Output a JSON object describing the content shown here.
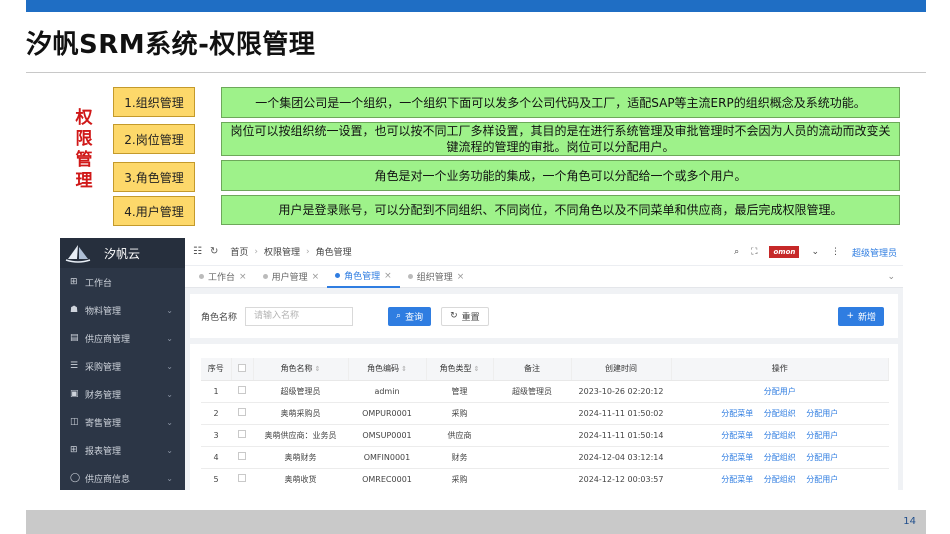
{
  "slide": {
    "title": "汐帆SRM系统-权限管理",
    "vertical_label": [
      "权",
      "限",
      "管",
      "理"
    ],
    "page_number": "14",
    "concepts": [
      {
        "label": "1.组织管理",
        "desc": "一个集团公司是一个组织，一个组织下面可以发多个公司代码及工厂，适配SAP等主流ERP的组织概念及系统功能。"
      },
      {
        "label": "2.岗位管理",
        "desc": "岗位可以按组织统一设置，也可以按不同工厂多样设置，其目的是在进行系统管理及审批管理时不会因为人员的流动而改变关键流程的管理的审批。岗位可以分配用户。"
      },
      {
        "label": "3.角色管理",
        "desc": "角色是对一个业务功能的集成，一个角色可以分配给一个或多个用户。"
      },
      {
        "label": "4.用户管理",
        "desc": "用户是登录账号，可以分配到不同组织、不同岗位，不同角色以及不同菜单和供应商，最后完成权限管理。"
      }
    ]
  },
  "app": {
    "brand": "汐帆云",
    "sidebar": [
      {
        "label": "工作台",
        "icon": "grid-icon"
      },
      {
        "label": "物料管理",
        "icon": "cubes-icon"
      },
      {
        "label": "供应商管理",
        "icon": "id-card-icon"
      },
      {
        "label": "采购管理",
        "icon": "list-icon"
      },
      {
        "label": "财务管理",
        "icon": "ledger-icon"
      },
      {
        "label": "寄售管理",
        "icon": "box-icon"
      },
      {
        "label": "报表管理",
        "icon": "grid-icon"
      },
      {
        "label": "供应商信息",
        "icon": "chat-icon"
      }
    ],
    "breadcrumb": [
      "首页",
      "权限管理",
      "角色管理"
    ],
    "user": "超级管理员",
    "badge_text": "omon",
    "tabs": [
      {
        "label": "工作台",
        "active": false
      },
      {
        "label": "用户管理",
        "active": false
      },
      {
        "label": "角色管理",
        "active": true
      },
      {
        "label": "组织管理",
        "active": false
      }
    ],
    "search": {
      "label": "角色名称",
      "placeholder": "请输入名称",
      "search_btn": "查询",
      "reset_btn": "重置",
      "add_btn": "新增"
    },
    "table": {
      "headers": [
        "序号",
        "",
        "角色名称",
        "角色编码",
        "角色类型",
        "备注",
        "创建时间",
        "操作"
      ],
      "rows": [
        {
          "no": "1",
          "name": "超级管理员",
          "code": "admin",
          "type": "管理",
          "remark": "超级管理员",
          "created": "2023-10-26 02:20:12",
          "ops": [
            "分配用户"
          ]
        },
        {
          "no": "2",
          "name": "奥萌采购员",
          "code": "OMPUR0001",
          "type": "采购",
          "remark": "",
          "created": "2024-11-11 01:50:02",
          "ops": [
            "分配菜单",
            "分配组织",
            "分配用户"
          ]
        },
        {
          "no": "3",
          "name": "奥萌供应商：业务员",
          "code": "OMSUP0001",
          "type": "供应商",
          "remark": "",
          "created": "2024-11-11 01:50:14",
          "ops": [
            "分配菜单",
            "分配组织",
            "分配用户"
          ]
        },
        {
          "no": "4",
          "name": "奥萌财务",
          "code": "OMFIN0001",
          "type": "财务",
          "remark": "",
          "created": "2024-12-04 03:12:14",
          "ops": [
            "分配菜单",
            "分配组织",
            "分配用户"
          ]
        },
        {
          "no": "5",
          "name": "奥萌收货",
          "code": "OMREC0001",
          "type": "采购",
          "remark": "",
          "created": "2024-12-12 00:03:57",
          "ops": [
            "分配菜单",
            "分配组织",
            "分配用户"
          ]
        }
      ]
    }
  }
}
